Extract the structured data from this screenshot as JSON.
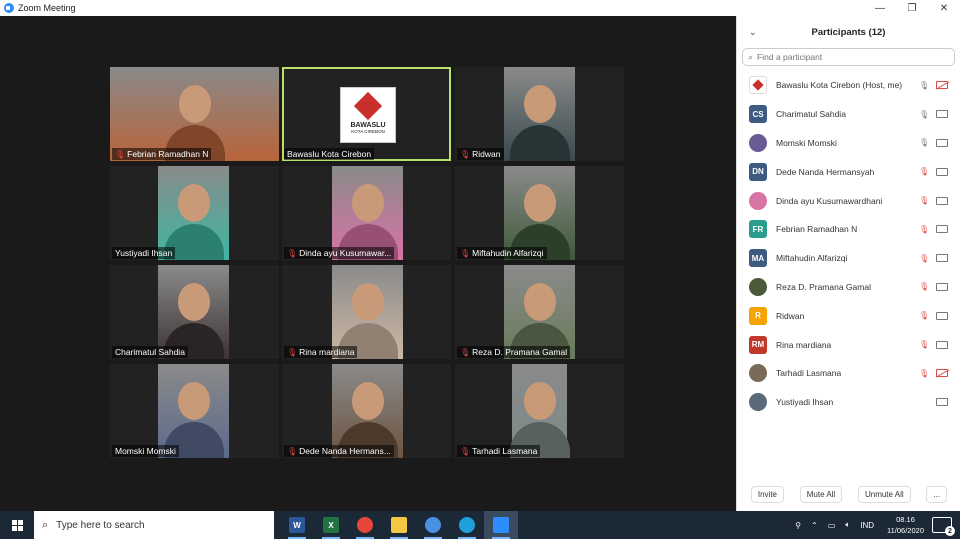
{
  "window": {
    "title": "Zoom Meeting",
    "controls": [
      "—",
      "❐",
      "✕"
    ]
  },
  "gallery": {
    "tiles": [
      {
        "name": "Febrian Ramadhan N",
        "muted": true,
        "color": "#b8643a"
      },
      {
        "name": "Bawaslu Kota Cirebon",
        "muted": false,
        "active": true,
        "logo_text": "BAWASLU",
        "logo_sub": "KOTA CIREBON"
      },
      {
        "name": "Ridwan",
        "muted": true,
        "color": "#3a4a4e"
      },
      {
        "name": "Yustiyadi Ihsan",
        "muted": false,
        "color": "#3fb7a3"
      },
      {
        "name": "Dinda ayu Kusumawar...",
        "muted": true,
        "color": "#d873a6"
      },
      {
        "name": "Miftahudin Alfarizqi",
        "muted": true,
        "color": "#3f5a3a"
      },
      {
        "name": "Charimatul Sahdia",
        "muted": false,
        "color": "#3d3334"
      },
      {
        "name": "Rina mardiana",
        "muted": true,
        "color": "#cdb8a4"
      },
      {
        "name": "Reza D. Pramana Gamal",
        "muted": true,
        "color": "#6a7b5a"
      },
      {
        "name": "Momski Momski",
        "muted": false,
        "color": "#5c6a8c"
      },
      {
        "name": "Dede Nanda Hermans...",
        "muted": true,
        "color": "#6d5440"
      },
      {
        "name": "Tarhadi Lasmana",
        "muted": true,
        "color": "#7d8a88"
      }
    ]
  },
  "participants": {
    "title": "Participants (12)",
    "search_placeholder": "Find a participant",
    "list": [
      {
        "name": "Bawaslu Kota Cirebon (Host, me)",
        "initials": "",
        "avatar_color": "#ffffff",
        "mic": "on",
        "cam": "off"
      },
      {
        "name": "Charimatul Sahdia",
        "initials": "CS",
        "avatar_color": "#3d5a80",
        "mic": "on",
        "cam": "on"
      },
      {
        "name": "Momski Momski",
        "initials": "",
        "avatar_color": "#6b5b95",
        "mic": "on",
        "cam": "on"
      },
      {
        "name": "Dede Nanda Hermansyah",
        "initials": "DN",
        "avatar_color": "#3d5a80",
        "mic": "off",
        "cam": "on"
      },
      {
        "name": "Dinda ayu Kusumawardhani",
        "initials": "",
        "avatar_color": "#d873a6",
        "mic": "off",
        "cam": "on"
      },
      {
        "name": "Febrian Ramadhan N",
        "initials": "FR",
        "avatar_color": "#2a9d8f",
        "mic": "off",
        "cam": "on"
      },
      {
        "name": "Miftahudin Alfarizqi",
        "initials": "MA",
        "avatar_color": "#3d5a80",
        "mic": "off",
        "cam": "on"
      },
      {
        "name": "Reza D. Pramana Gamal",
        "initials": "",
        "avatar_color": "#4a5a3a",
        "mic": "off",
        "cam": "on"
      },
      {
        "name": "Ridwan",
        "initials": "R",
        "avatar_color": "#f4a300",
        "mic": "off",
        "cam": "on"
      },
      {
        "name": "Rina mardiana",
        "initials": "RM",
        "avatar_color": "#c0392b",
        "mic": "off",
        "cam": "on"
      },
      {
        "name": "Tarhadi Lasmana",
        "initials": "",
        "avatar_color": "#7a6a5a",
        "mic": "off",
        "cam": "off"
      },
      {
        "name": "Yustiyadi Ihsan",
        "initials": "",
        "avatar_color": "#5a6a7a",
        "mic": "none",
        "cam": "on"
      }
    ],
    "buttons": {
      "invite": "Invite",
      "mute_all": "Mute All",
      "unmute_all": "Unmute All",
      "more": "..."
    }
  },
  "taskbar": {
    "search_placeholder": "Type here to search",
    "apps": [
      {
        "name": "word",
        "label": "W",
        "color": "#2b579a"
      },
      {
        "name": "excel",
        "label": "X",
        "color": "#217346"
      },
      {
        "name": "chrome",
        "label": "",
        "color": "#e8453c"
      },
      {
        "name": "file-explorer",
        "label": "",
        "color": "#f2c744"
      },
      {
        "name": "chrome-alt",
        "label": "",
        "color": "#4a90e2"
      },
      {
        "name": "edge",
        "label": "",
        "color": "#1fa0d8"
      },
      {
        "name": "zoom",
        "label": "",
        "color": "#2d8cff"
      }
    ],
    "language": "IND",
    "time": "08.16",
    "date": "11/06/2020",
    "notifications": "2"
  }
}
